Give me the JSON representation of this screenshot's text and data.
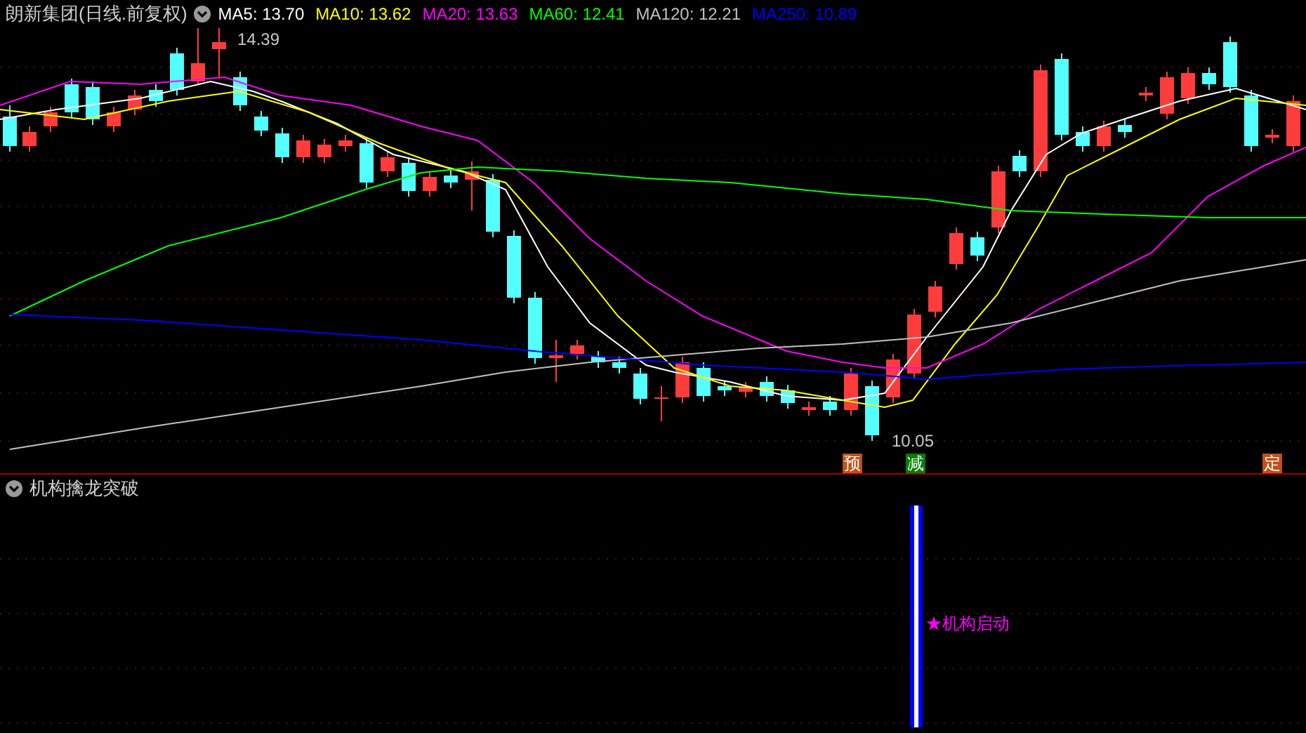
{
  "title": "朗新集团(日线.前复权)",
  "ma_legend": [
    {
      "label": "MA5: 13.70",
      "color": "#ffffff"
    },
    {
      "label": "MA10: 13.62",
      "color": "#ffff00"
    },
    {
      "label": "MA20: 13.63",
      "color": "#ff00ff"
    },
    {
      "label": "MA60: 12.41",
      "color": "#00ff00"
    },
    {
      "label": "MA120: 12.21",
      "color": "#c0c0c0"
    },
    {
      "label": "MA250: 10.89",
      "color": "#0000ff"
    }
  ],
  "price_chart": {
    "high_label": "14.39",
    "low_label": "10.05",
    "signals": [
      {
        "text": "预",
        "color": "#c0501a"
      },
      {
        "text": "减",
        "color": "#008000"
      },
      {
        "text": "定",
        "color": "#c0501a"
      }
    ]
  },
  "indicator": {
    "title": "机构擒龙突破",
    "signal_text": "★机构启动"
  }
}
